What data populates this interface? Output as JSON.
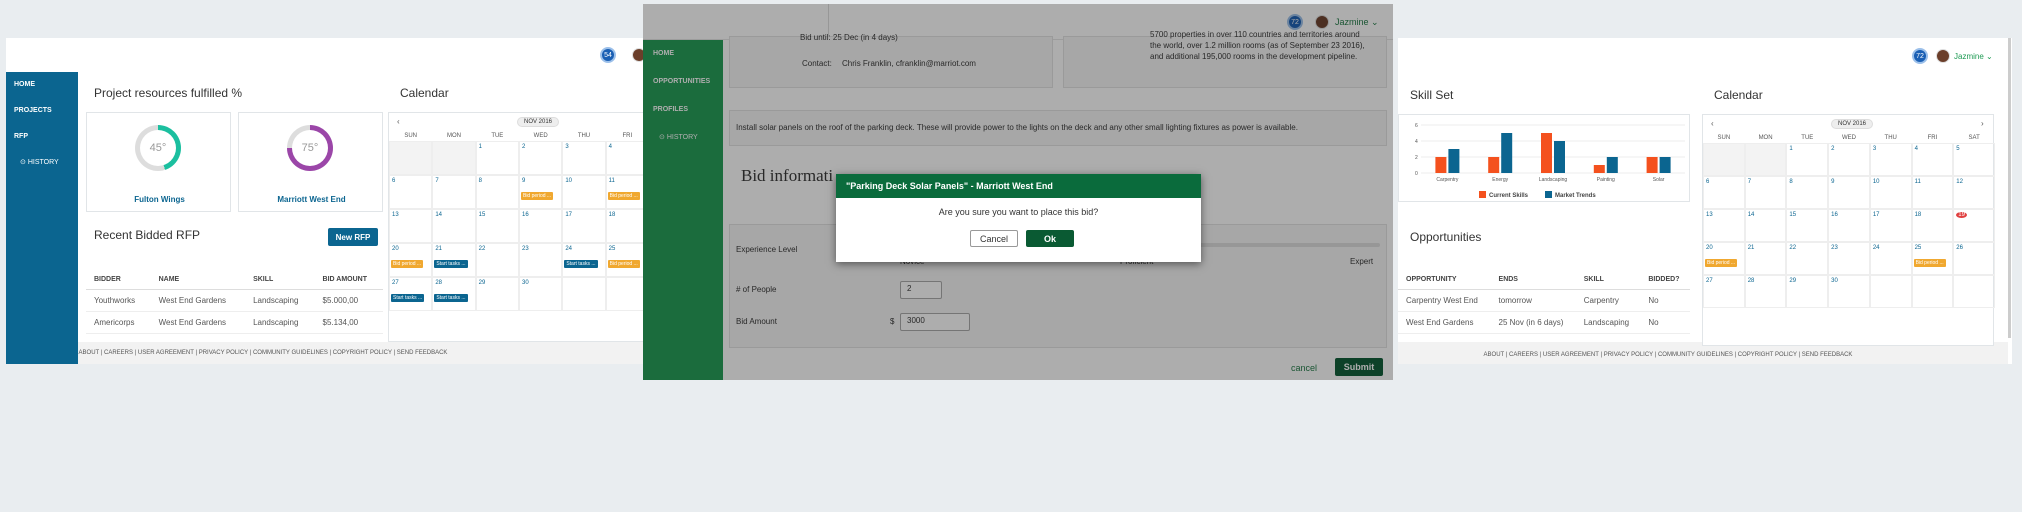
{
  "left": {
    "badge": "54",
    "nav": [
      "HOME",
      "PROJECTS",
      "RFP",
      "History"
    ],
    "resources_title": "Project resources fulfilled %",
    "rings": [
      {
        "name": "Fulton Wings",
        "value": "45",
        "color": "#1bbf9f"
      },
      {
        "name": "Marriott West End",
        "value": "75",
        "color": "#9b46a8"
      }
    ],
    "recent_title": "Recent Bidded RFP",
    "new_rfp": "New RFP",
    "table_headers": [
      "BIDDER",
      "NAME",
      "SKILL",
      "BID AMOUNT"
    ],
    "rows": [
      [
        "Youthworks",
        "West End Gardens",
        "Landscaping",
        "$5.000,00"
      ],
      [
        "Americorps",
        "West End Gardens",
        "Landscaping",
        "$5.134,00"
      ]
    ],
    "footer": "ABOUT | CAREERS | USER AGREEMENT | PRIVACY POLICY | COMMUNITY GUIDELINES | COPYRIGHT POLICY | SEND FEEDBACK",
    "calendar_title": "Calendar",
    "calendar_month": "NOV 2016",
    "day_names": [
      "SUN",
      "MON",
      "TUE",
      "WED",
      "THU",
      "FRI"
    ],
    "event_bid": "Bid period ...",
    "event_start": "Start tasks ..."
  },
  "mid": {
    "badge": "72",
    "user": "Jazmine",
    "nav": [
      "HOME",
      "OPPORTUNITIES",
      "PROFILES",
      "History"
    ],
    "bid_until_label": "Bid until:",
    "bid_until_value": "25 Dec (in 4 days)",
    "contact_label": "Contact:",
    "contact_value": "Chris Franklin, cfranklin@marriot.com",
    "hotel_desc": "5700 properties in over 110 countries and territories around the world, over 1.2 million rooms (as of September 23 2016), and additional 195,000 rooms in the development pipeline.",
    "project_desc": "Install solar panels on the roof of the parking deck. These will provide power to the lights on the deck and any other small lighting fixtures as power is available.",
    "bid_info_title": "Bid informati",
    "experience_label": "Experience Level",
    "levels": [
      "Novice",
      "Proficient",
      "Expert"
    ],
    "people_label": "# of People",
    "people_value": "2",
    "bid_amount_label": "Bid Amount",
    "currency": "$",
    "bid_amount_value": "3000",
    "cancel": "cancel",
    "submit": "Submit",
    "modal": {
      "title": "\"Parking Deck Solar Panels\" - Marriott West End",
      "question": "Are you sure you want to place this bid?",
      "cancel": "Cancel",
      "ok": "Ok"
    }
  },
  "right": {
    "badge": "72",
    "user": "Jazmine",
    "skill_title": "Skill Set",
    "calendar_title": "Calendar",
    "calendar_month": "NOV 2016",
    "day_names": [
      "SUN",
      "MON",
      "TUE",
      "WED",
      "THU",
      "FRI",
      "SAT"
    ],
    "opps_title": "Opportunities",
    "opp_headers": [
      "OPPORTUNITY",
      "ENDS",
      "SKILL",
      "BIDDED?"
    ],
    "opps": [
      [
        "Carpentry West End",
        "tomorrow",
        "Carpentry",
        "No"
      ],
      [
        "West End Gardens",
        "25 Nov (in 6 days)",
        "Landscaping",
        "No"
      ]
    ],
    "event_bid": "Bid period ...",
    "footer": "ABOUT | CAREERS | USER AGREEMENT | PRIVACY POLICY | COMMUNITY GUIDELINES | COPYRIGHT POLICY | SEND FEEDBACK"
  },
  "chart_data": {
    "type": "bar",
    "categories": [
      "Carpentry",
      "Energy",
      "Landscaping",
      "Painting",
      "Solar"
    ],
    "series": [
      {
        "name": "Current Skills",
        "color": "#f4511e",
        "values": [
          2,
          2,
          5,
          1,
          2
        ]
      },
      {
        "name": "Market Trends",
        "color": "#0b6590",
        "values": [
          3,
          5,
          4,
          2,
          2
        ]
      }
    ],
    "yticks": [
      0,
      2,
      4,
      6
    ],
    "ylim": [
      0,
      6
    ],
    "legend": "bottom"
  }
}
